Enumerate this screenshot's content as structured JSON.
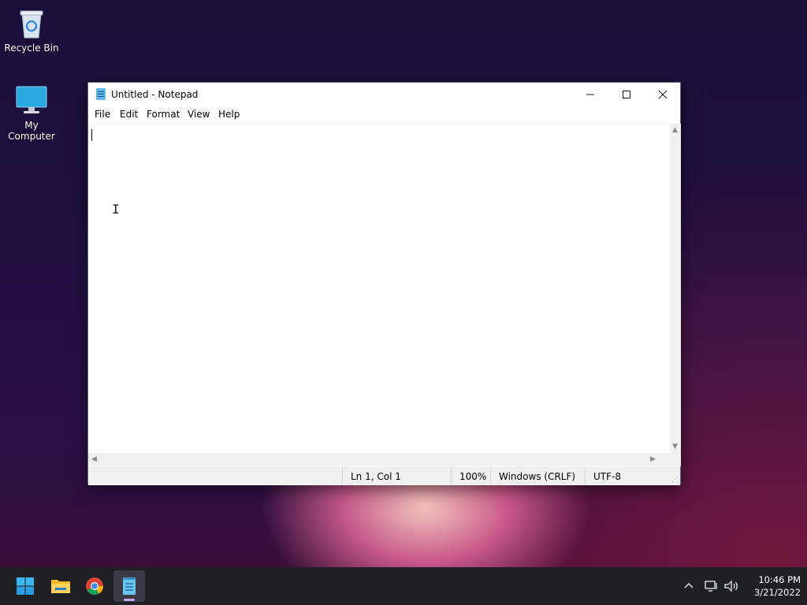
{
  "desktop": {
    "icons": [
      {
        "label": "Recycle Bin",
        "icon": "recycle-bin-icon"
      },
      {
        "label": "My Computer",
        "icon": "monitor-icon"
      }
    ]
  },
  "notepad": {
    "title": "Untitled - Notepad",
    "menu": [
      "File",
      "Edit",
      "Format",
      "View",
      "Help"
    ],
    "content": "",
    "status": {
      "position": "Ln 1, Col 1",
      "zoom": "100%",
      "line_endings": "Windows (CRLF)",
      "encoding": "UTF-8"
    }
  },
  "taskbar": {
    "apps": [
      {
        "name": "Start",
        "icon": "windows-start-icon"
      },
      {
        "name": "File Explorer",
        "icon": "folder-icon"
      },
      {
        "name": "Google Chrome",
        "icon": "chrome-icon"
      },
      {
        "name": "Notepad",
        "icon": "notepad-icon",
        "active": true
      }
    ],
    "clock": {
      "time": "10:46 PM",
      "date": "3/21/2022"
    }
  },
  "colors": {
    "taskbar_bg": "#1f1f26",
    "accent": "#c9a6ff",
    "window_bg": "#ffffff",
    "status_bg": "#f0f0f0"
  }
}
